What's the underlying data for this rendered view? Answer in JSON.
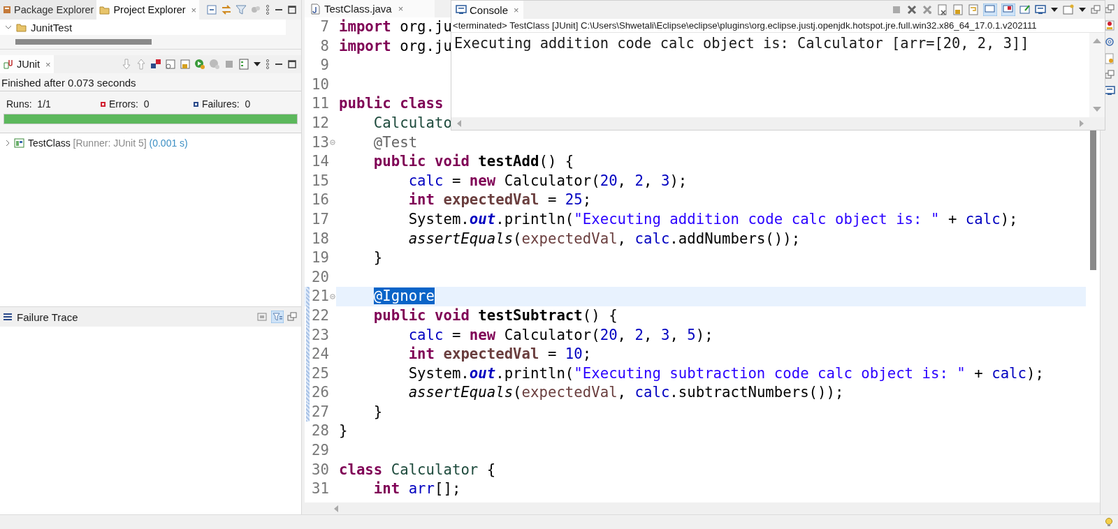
{
  "explorer": {
    "tabs": [
      {
        "label": "Package Explorer",
        "selected": false
      },
      {
        "label": "Project Explorer",
        "selected": true,
        "close": "×"
      }
    ],
    "tree": [
      {
        "label": "JunitTest",
        "expanded": true
      }
    ]
  },
  "junit": {
    "tab": {
      "label": "JUnit",
      "close": "×"
    },
    "status": "Finished after 0.073 seconds",
    "counters": [
      {
        "kind": "runs",
        "label": "Runs:",
        "value": "1/1"
      },
      {
        "kind": "errors",
        "label": "Errors:",
        "value": "0"
      },
      {
        "kind": "failures",
        "label": "Failures:",
        "value": "0"
      }
    ],
    "progress": {
      "level": 1
    },
    "results": [
      {
        "name": "TestClass",
        "runner": "[Runner: JUnit 5]",
        "time": "(0.001 s)",
        "expanded": false
      }
    ],
    "failure_trace": {
      "title": "Failure Trace"
    }
  },
  "editor": {
    "tab": {
      "label": "TestClass.java",
      "close": "×"
    },
    "lines": [
      {
        "number": "7",
        "tokens": [
          {
            "kind": "kw",
            "text": "import"
          },
          {
            "kind": "plain",
            "text": " org.ju"
          }
        ]
      },
      {
        "number": "8",
        "tokens": [
          {
            "kind": "kw",
            "text": "import"
          },
          {
            "kind": "plain",
            "text": " org.ju"
          }
        ]
      },
      {
        "number": "9"
      },
      {
        "number": "10"
      },
      {
        "number": "11",
        "tokens": [
          {
            "kind": "kw",
            "text": "public"
          },
          {
            "kind": "kw",
            "text": " class"
          }
        ]
      },
      {
        "number": "12",
        "tokens": [
          {
            "kind": "type",
            "text": "    Calculato"
          }
        ]
      },
      {
        "number": "13",
        "fold": true,
        "tokens": [
          {
            "kind": "ann",
            "text": "    @Test"
          }
        ]
      },
      {
        "number": "14",
        "tokens": [
          {
            "kind": "kw",
            "text": "    public"
          },
          {
            "kind": "kw",
            "text": " void"
          },
          {
            "kind": "decl",
            "text": " testAdd"
          },
          {
            "kind": "plain",
            "text": "() {"
          }
        ]
      },
      {
        "number": "15",
        "tokens": [
          {
            "kind": "field",
            "text": "        calc"
          },
          {
            "kind": "plain",
            "text": " = "
          },
          {
            "kind": "kw",
            "text": "new"
          },
          {
            "kind": "plain",
            "text": " Calculator("
          },
          {
            "kind": "num",
            "text": "20"
          },
          {
            "kind": "plain",
            "text": ", "
          },
          {
            "kind": "num",
            "text": "2"
          },
          {
            "kind": "plain",
            "text": ", "
          },
          {
            "kind": "num",
            "text": "3"
          },
          {
            "kind": "plain",
            "text": ");"
          }
        ]
      },
      {
        "number": "16",
        "tokens": [
          {
            "kind": "kw",
            "text": "        int"
          },
          {
            "kind": "localdecl",
            "text": " expectedVal"
          },
          {
            "kind": "plain",
            "text": " = "
          },
          {
            "kind": "num",
            "text": "25"
          },
          {
            "kind": "plain",
            "text": ";"
          }
        ]
      },
      {
        "number": "17",
        "tokens": [
          {
            "kind": "plain",
            "text": "        System."
          },
          {
            "kind": "static",
            "text": "out"
          },
          {
            "kind": "plain",
            "text": ".println("
          },
          {
            "kind": "str",
            "text": "\"Executing addition code calc object is: \""
          },
          {
            "kind": "plain",
            "text": " + "
          },
          {
            "kind": "field",
            "text": "calc"
          },
          {
            "kind": "plain",
            "text": ");"
          }
        ]
      },
      {
        "number": "18",
        "tokens": [
          {
            "kind": "smethod",
            "text": "        assertEquals"
          },
          {
            "kind": "plain",
            "text": "("
          },
          {
            "kind": "local",
            "text": "expectedVal"
          },
          {
            "kind": "plain",
            "text": ", "
          },
          {
            "kind": "field",
            "text": "calc"
          },
          {
            "kind": "plain",
            "text": ".addNumbers());"
          }
        ]
      },
      {
        "number": "19",
        "tokens": [
          {
            "kind": "plain",
            "text": "    }"
          }
        ]
      },
      {
        "number": "20"
      },
      {
        "number": "21",
        "fold": true,
        "current": true,
        "changed": true,
        "tokens": [
          {
            "kind": "sel",
            "text": "@Ignore"
          }
        ]
      },
      {
        "number": "22",
        "changed": true,
        "tokens": [
          {
            "kind": "kw",
            "text": "    public"
          },
          {
            "kind": "kw",
            "text": " void"
          },
          {
            "kind": "decl",
            "text": " testSubtract"
          },
          {
            "kind": "plain",
            "text": "() {"
          }
        ]
      },
      {
        "number": "23",
        "changed": true,
        "tokens": [
          {
            "kind": "field",
            "text": "        calc"
          },
          {
            "kind": "plain",
            "text": " = "
          },
          {
            "kind": "kw",
            "text": "new"
          },
          {
            "kind": "plain",
            "text": " Calculator("
          },
          {
            "kind": "num",
            "text": "20"
          },
          {
            "kind": "plain",
            "text": ", "
          },
          {
            "kind": "num",
            "text": "2"
          },
          {
            "kind": "plain",
            "text": ", "
          },
          {
            "kind": "num",
            "text": "3"
          },
          {
            "kind": "plain",
            "text": ", "
          },
          {
            "kind": "num",
            "text": "5"
          },
          {
            "kind": "plain",
            "text": ");"
          }
        ]
      },
      {
        "number": "24",
        "changed": true,
        "tokens": [
          {
            "kind": "kw",
            "text": "        int"
          },
          {
            "kind": "localdecl",
            "text": " expectedVal"
          },
          {
            "kind": "plain",
            "text": " = "
          },
          {
            "kind": "num",
            "text": "10"
          },
          {
            "kind": "plain",
            "text": ";"
          }
        ]
      },
      {
        "number": "25",
        "changed": true,
        "tokens": [
          {
            "kind": "plain",
            "text": "        System."
          },
          {
            "kind": "static",
            "text": "out"
          },
          {
            "kind": "plain",
            "text": ".println("
          },
          {
            "kind": "str",
            "text": "\"Executing subtraction code calc object is: \""
          },
          {
            "kind": "plain",
            "text": " + "
          },
          {
            "kind": "field",
            "text": "calc"
          },
          {
            "kind": "plain",
            "text": ");"
          }
        ]
      },
      {
        "number": "26",
        "changed": true,
        "tokens": [
          {
            "kind": "smethod",
            "text": "        assertEquals"
          },
          {
            "kind": "plain",
            "text": "("
          },
          {
            "kind": "local",
            "text": "expectedVal"
          },
          {
            "kind": "plain",
            "text": ", "
          },
          {
            "kind": "field",
            "text": "calc"
          },
          {
            "kind": "plain",
            "text": ".subtractNumbers());"
          }
        ]
      },
      {
        "number": "27",
        "changed": true,
        "tokens": [
          {
            "kind": "plain",
            "text": "    }"
          }
        ]
      },
      {
        "number": "28",
        "tokens": [
          {
            "kind": "plain",
            "text": "}"
          }
        ]
      },
      {
        "number": "29"
      },
      {
        "number": "30",
        "tokens": [
          {
            "kind": "kw",
            "text": "class"
          },
          {
            "kind": "type",
            "text": " Calculator"
          },
          {
            "kind": "plain",
            "text": " {"
          }
        ]
      },
      {
        "number": "31",
        "tokens": [
          {
            "kind": "kw",
            "text": "    int"
          },
          {
            "kind": "field",
            "text": " arr"
          },
          {
            "kind": "plain",
            "text": "[];"
          }
        ]
      }
    ]
  },
  "console": {
    "tab": {
      "label": "Console",
      "close": "×"
    },
    "process": "<terminated> TestClass [JUnit] C:\\Users\\Shwetali\\Eclipse\\eclipse\\plugins\\org.eclipse.justj.openjdk.hotspot.jre.full.win32.x86_64_17.0.1.v202111",
    "output": [
      "Executing addition code calc object is: Calculator [arr=[20, 2, 3]]"
    ]
  }
}
